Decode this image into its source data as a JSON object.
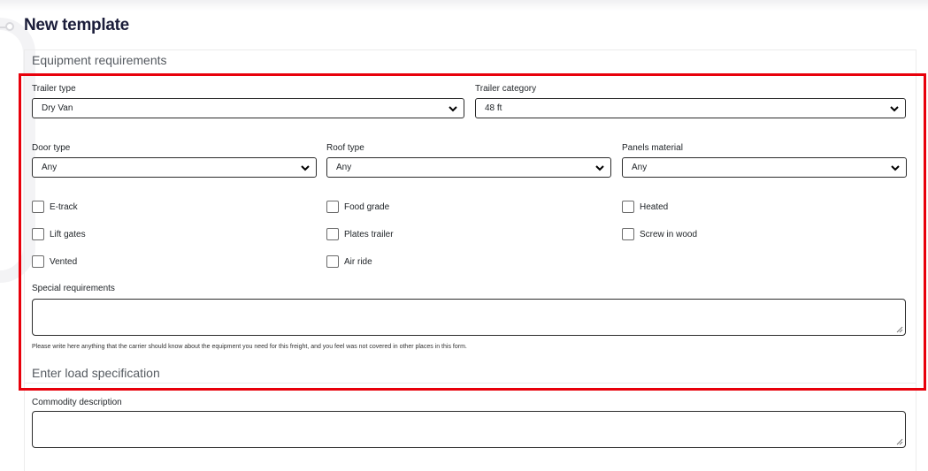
{
  "page": {
    "title": "New template"
  },
  "equipment": {
    "heading": "Equipment requirements",
    "trailer_type": {
      "label": "Trailer type",
      "value": "Dry Van"
    },
    "trailer_category": {
      "label": "Trailer category",
      "value": "48 ft"
    },
    "door_type": {
      "label": "Door type",
      "value": "Any"
    },
    "roof_type": {
      "label": "Roof type",
      "value": "Any"
    },
    "panels_material": {
      "label": "Panels material",
      "value": "Any"
    },
    "checkboxes": {
      "etrack": "E-track",
      "food_grade": "Food grade",
      "heated": "Heated",
      "lift_gates": "Lift gates",
      "plates_trailer": "Plates trailer",
      "screw_in_wood": "Screw in wood",
      "vented": "Vented",
      "air_ride": "Air ride"
    },
    "special": {
      "label": "Special requirements",
      "value": "",
      "help": "Please write here anything that the carrier should know about the equipment you need for this freight, and you feel was not covered in other places in this form."
    }
  },
  "load": {
    "heading": "Enter load specification",
    "commodity": {
      "label": "Commodity description",
      "value": ""
    }
  },
  "colors": {
    "highlight": "#e8000b",
    "title": "#1b1d3a"
  }
}
